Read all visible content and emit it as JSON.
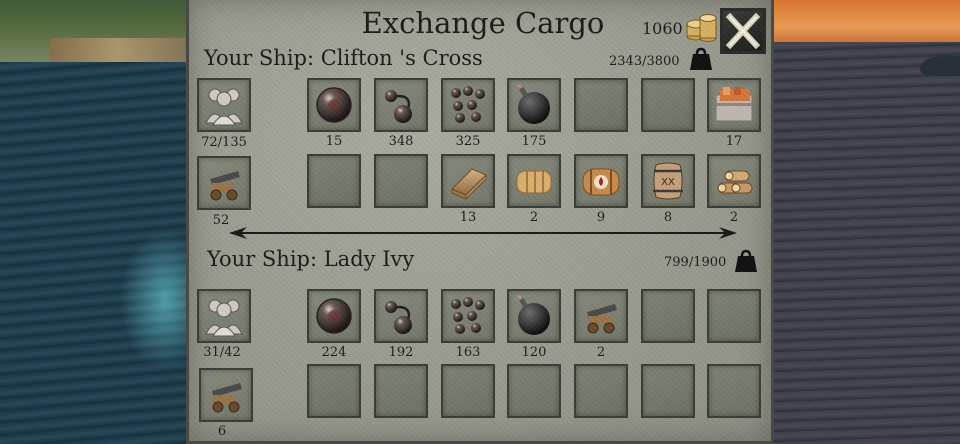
{
  "title": "Exchange Cargo",
  "gold": "1060",
  "icons": {
    "gold": "coins-icon",
    "close": "close-x-icon",
    "weight": "weight-icon"
  },
  "ship1": {
    "name": "Your Ship: Clifton 's Cross",
    "weight": "2343/3800",
    "crew": "72/135",
    "cannons": "52",
    "row1": [
      {
        "item": "cannonball",
        "count": "15"
      },
      {
        "item": "chain-shot",
        "count": "348"
      },
      {
        "item": "grapeshot",
        "count": "325"
      },
      {
        "item": "bomb",
        "count": "175"
      },
      {
        "item": "",
        "count": ""
      },
      {
        "item": "",
        "count": ""
      },
      {
        "item": "crate",
        "count": "17"
      }
    ],
    "row2": [
      {
        "item": "",
        "count": ""
      },
      {
        "item": "",
        "count": ""
      },
      {
        "item": "planks",
        "count": "13"
      },
      {
        "item": "sailcloth",
        "count": "2"
      },
      {
        "item": "rum-barrel",
        "count": "9"
      },
      {
        "item": "barrel",
        "count": "8"
      },
      {
        "item": "logs",
        "count": "2"
      }
    ]
  },
  "ship2": {
    "name": "Your Ship: Lady Ivy",
    "weight": "799/1900",
    "crew": "31/42",
    "cannons": "6",
    "row1": [
      {
        "item": "cannonball",
        "count": "224"
      },
      {
        "item": "chain-shot",
        "count": "192"
      },
      {
        "item": "grapeshot",
        "count": "163"
      },
      {
        "item": "bomb",
        "count": "120"
      },
      {
        "item": "cannon",
        "count": "2"
      },
      {
        "item": "",
        "count": ""
      },
      {
        "item": "",
        "count": ""
      }
    ],
    "row2": [
      {
        "item": "",
        "count": ""
      },
      {
        "item": "",
        "count": ""
      },
      {
        "item": "",
        "count": ""
      },
      {
        "item": "",
        "count": ""
      },
      {
        "item": "",
        "count": ""
      },
      {
        "item": "",
        "count": ""
      },
      {
        "item": "",
        "count": ""
      }
    ]
  }
}
